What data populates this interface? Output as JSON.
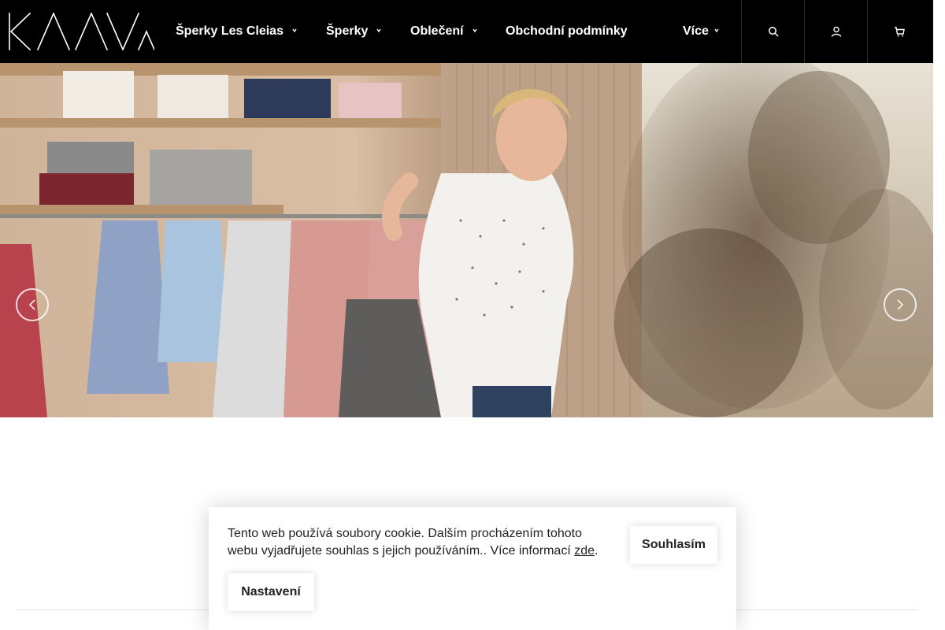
{
  "brand": {
    "logo_text": "KAAVA"
  },
  "nav": {
    "items": [
      {
        "label": "Šperky Les Cleias",
        "has_submenu": true
      },
      {
        "label": "Šperky",
        "has_submenu": true
      },
      {
        "label": "Oblečení",
        "has_submenu": true
      },
      {
        "label": "Obchodní podmínky",
        "has_submenu": false
      },
      {
        "label": "Více",
        "has_submenu": true
      }
    ]
  },
  "header_buttons": [
    {
      "icon": "search-icon"
    },
    {
      "icon": "user-icon"
    },
    {
      "icon": "cart-icon"
    }
  ],
  "hero": {
    "image": "woman-in-clothing-shop-photo",
    "prev_icon": "chevron-left-icon",
    "next_icon": "chevron-right-icon"
  },
  "cookie_bar": {
    "text": "Tento web používá soubory cookie. Dalším procházením tohoto webu vyjadřujete souhlas s jejich používáním.. Více informací ",
    "link_label": "zde",
    "trailing": ".",
    "accept_label": "Souhlasím",
    "settings_label": "Nastavení"
  },
  "colors": {
    "header_bg": "#000000",
    "text": "#222222",
    "white": "#ffffff"
  }
}
